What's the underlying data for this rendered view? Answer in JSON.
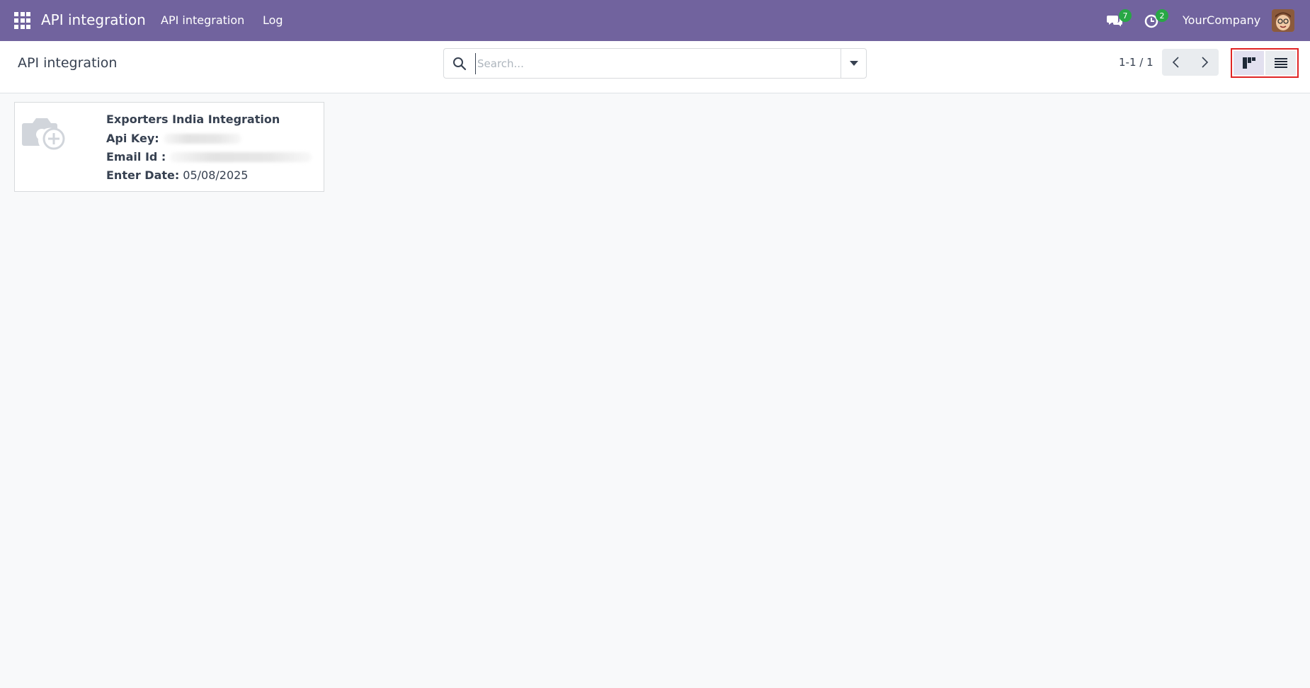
{
  "navbar": {
    "brand": "API integration",
    "menu": [
      {
        "label": "API integration"
      },
      {
        "label": "Log"
      }
    ],
    "messages_count": "7",
    "activities_count": "2",
    "company": "YourCompany",
    "background_color": "#71639e"
  },
  "control_panel": {
    "title": "API integration",
    "search": {
      "placeholder": "Search...",
      "value": ""
    },
    "pager": "1-1 / 1"
  },
  "kanban": {
    "cards": [
      {
        "title": "Exporters India Integration",
        "api_key_label": "Api Key:",
        "email_label": "Email Id :",
        "date_label": "Enter Date:",
        "date_value": "05/08/2025"
      }
    ]
  },
  "colors": {
    "accent": "#71639e",
    "badge": "#28a745",
    "highlight_border": "#e02424"
  }
}
